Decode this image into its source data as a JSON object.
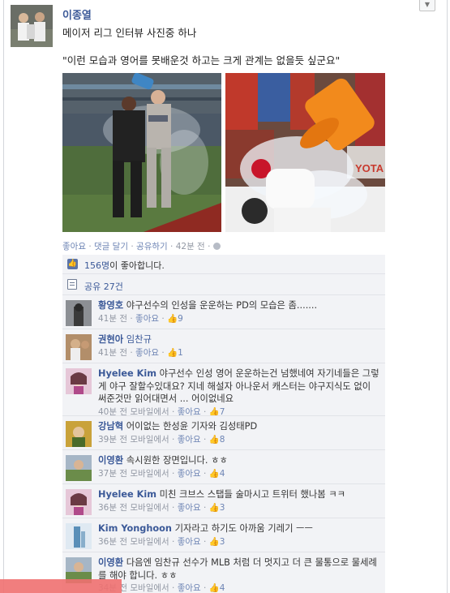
{
  "post": {
    "author": "이종열",
    "line1": "메이저 리그 인터뷰 사진중 하나",
    "line2": "\"이런 모습과 영어를 못배운것 하고는 크게 관계는 없을듯 싶군요\"",
    "photo2_banner": "YOTA",
    "actions": {
      "like": "좋아요",
      "comment": "댓글 달기",
      "share": "공유하기",
      "time": "42분 전",
      "sep": "·"
    },
    "likes_count": "156명",
    "likes_suffix": "이 좋아합니다.",
    "share_count": "공유 27건"
  },
  "comments": [
    {
      "name": "황영호",
      "text": "야구선수의 인성을 운운하는 PD의 모습은 좀.......",
      "time": "41분 전",
      "via": "",
      "like": "좋아요",
      "count": "9"
    },
    {
      "name": "권현아",
      "text": "임찬규",
      "time": "41분 전",
      "via": "",
      "like": "좋아요",
      "count": "1",
      "tag": true
    },
    {
      "name": "Hyelee Kim",
      "text": "야구선수 인성 영어 운운하는건 넘했네여 자기네들은 그렇게 야구 잘할수있대요? 지네 해설자 아나운서 캐스터는 야구지식도 없이 써준것만 읽어대면서 ... 어이없네요",
      "time": "40분 전",
      "via": "모바일에서",
      "like": "좋아요",
      "count": "7"
    },
    {
      "name": "강남혁",
      "text": "어이없는 한성윤 기자와 김성태PD",
      "time": "39분 전",
      "via": "모바일에서",
      "like": "좋아요",
      "count": "8"
    },
    {
      "name": "이영환",
      "text": "속시원한 장면입니다. ㅎㅎ",
      "time": "37분 전",
      "via": "모바일에서",
      "like": "좋아요",
      "count": "4"
    },
    {
      "name": "Hyelee Kim",
      "text": "미친 크브스 스탭들 술마시고 트위터 했나봄 ㅋㅋ",
      "time": "36분 전",
      "via": "모바일에서",
      "like": "좋아요",
      "count": "3"
    },
    {
      "name": "Kim Yonghoon",
      "text": "기자라고 하기도 아까움 기레기 ㅡㅡ",
      "time": "36분 전",
      "via": "모바일에서",
      "like": "좋아요",
      "count": "3"
    },
    {
      "name": "이영환",
      "text": "다음엔 임찬규 선수가 MLB 처럼 더 멋지고 더 큰 물통으로 물세례를 해야 합니다. ㅎㅎ",
      "time": "34분 전",
      "via": "모바일에서",
      "like": "좋아요",
      "count": "4"
    }
  ],
  "colors": {
    "link": "#3b5998",
    "meta": "#9197a3",
    "ufi_bg": "#f2f3f6"
  }
}
